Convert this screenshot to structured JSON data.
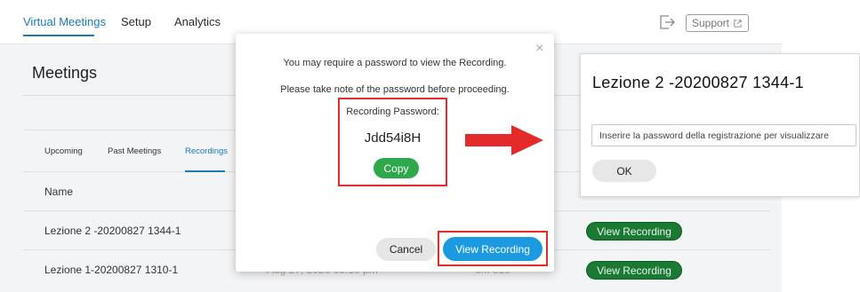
{
  "nav": {
    "tabs": [
      {
        "label": "Virtual Meetings",
        "active": true
      },
      {
        "label": "Setup",
        "active": false
      },
      {
        "label": "Analytics",
        "active": false
      }
    ],
    "support_label": "Support"
  },
  "page": {
    "title": "Meetings",
    "subtabs": [
      {
        "label": "Upcoming",
        "active": false
      },
      {
        "label": "Past Meetings",
        "active": false
      },
      {
        "label": "Recordings",
        "active": true
      }
    ],
    "table": {
      "header_name": "Name",
      "rows": [
        {
          "name": "Lezione 2 -20200827 1344-1",
          "date": "",
          "duration": "",
          "action": "View Recording"
        },
        {
          "name": "Lezione 1-20200827 1310-1",
          "date": "Aug 27, 2020 03:10 pm",
          "duration": "6m 31s",
          "action": "View Recording"
        }
      ]
    }
  },
  "modal": {
    "close_symbol": "×",
    "line1": "You may require a password to view the Recording.",
    "line2": "Please take note of the password before proceeding.",
    "password_label": "Recording Password:",
    "password_value": "Jdd54i8H",
    "copy_label": "Copy",
    "cancel_label": "Cancel",
    "view_label": "View Recording"
  },
  "password_panel": {
    "title": "Lezione 2 -20200827 1344-1",
    "input_placeholder": "Inserire la password della registrazione per visualizzare",
    "ok_label": "OK"
  },
  "colors": {
    "accent": "#1b79b8",
    "highlight_red": "#e52a2a",
    "copy_green": "#2ea84a",
    "view_blue": "#1c9ae0",
    "recording_green": "#1a7a33"
  },
  "icons": {
    "exit": "exit-icon",
    "external_link": "external-link-icon",
    "arrow": "right-arrow-icon"
  }
}
